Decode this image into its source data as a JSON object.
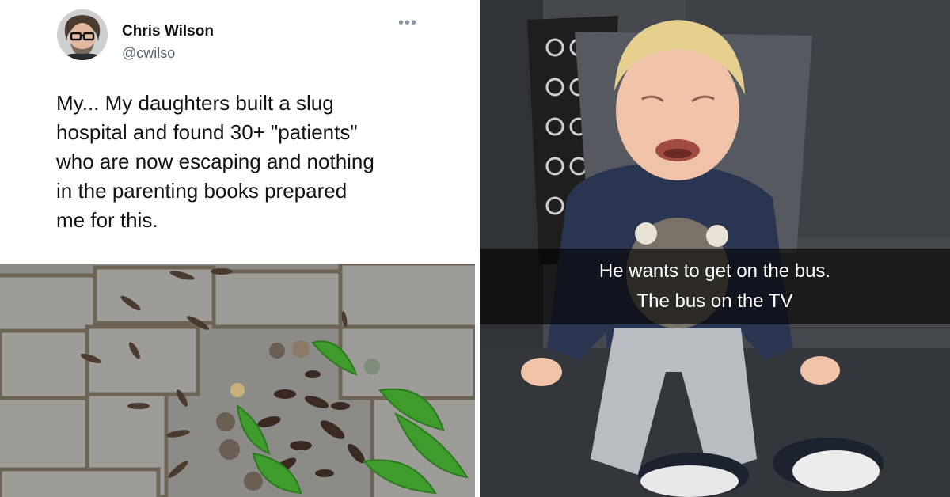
{
  "tweet": {
    "author_name": "Chris Wilson",
    "author_handle": "@cwilso",
    "more_icon": "more-horizontal-icon",
    "text_lines": [
      "My... My daughters built a slug",
      "hospital and found 30+ \"patients\"",
      "who are now escaping and nothing",
      "in the parenting books prepared",
      "me for this."
    ]
  },
  "meme_caption": {
    "line1": "He wants to get on the bus.",
    "line2": "The bus on the TV"
  },
  "colors": {
    "name_text": "#0f1419",
    "handle_text": "#536471",
    "caption_bg": "#000000",
    "caption_text": "#ffffff"
  }
}
